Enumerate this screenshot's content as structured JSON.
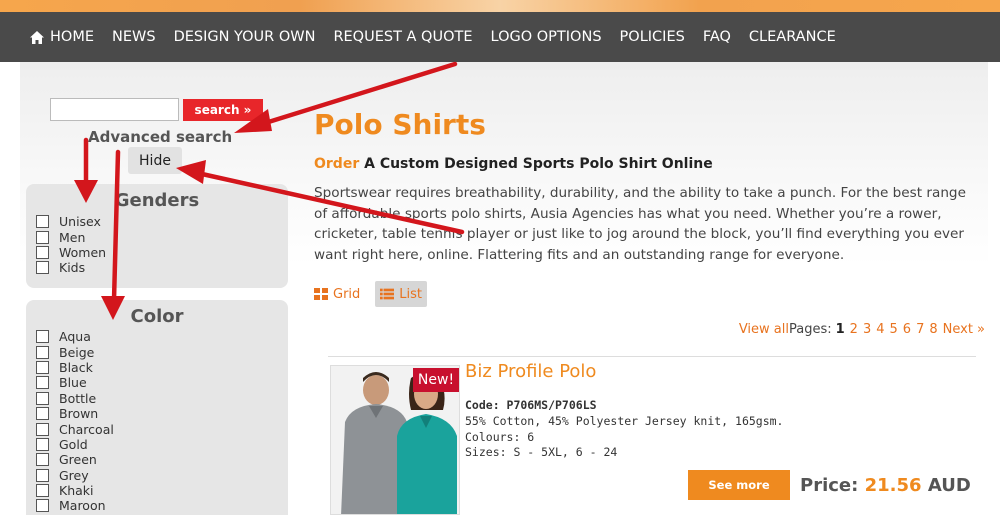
{
  "nav": {
    "items": [
      {
        "label": "HOME",
        "icon": "home-icon"
      },
      {
        "label": "NEWS"
      },
      {
        "label": "DESIGN YOUR OWN"
      },
      {
        "label": "REQUEST A QUOTE"
      },
      {
        "label": "LOGO OPTIONS"
      },
      {
        "label": "POLICIES"
      },
      {
        "label": "FAQ"
      },
      {
        "label": "CLEARANCE"
      }
    ]
  },
  "sidebar": {
    "search_value": "",
    "search_button": "search »",
    "advanced_search": "Advanced search",
    "hide_button": "Hide",
    "genders": {
      "title": "Genders",
      "options": [
        "Unisex",
        "Men",
        "Women",
        "Kids"
      ]
    },
    "color": {
      "title": "Color",
      "options": [
        "Aqua",
        "Beige",
        "Black",
        "Blue",
        "Bottle",
        "Brown",
        "Charcoal",
        "Gold",
        "Green",
        "Grey",
        "Khaki",
        "Maroon"
      ]
    }
  },
  "main": {
    "title": "Polo Shirts",
    "subtitle_accent": "Order",
    "subtitle_rest": "A Custom Designed Sports Polo Shirt Online",
    "description": "Sportswear requires breathability, durability, and the ability to take a punch. For the best range of affordable sports polo shirts, Ausia Agencies has what you need. Whether you’re a rower, cricketer, table tennis player or just like to jog around the block, you’ll find everything you ever want right here, online. Flattering fits and an outstanding range for everyone.",
    "view_grid": "Grid",
    "view_list": "List",
    "selected_view": "List",
    "pagination": {
      "view_all": "View all",
      "pages_label": "Pages:",
      "current": "1",
      "pages": [
        "2",
        "3",
        "4",
        "5",
        "6",
        "7",
        "8"
      ],
      "next": "Next »"
    },
    "product": {
      "badge": "New!",
      "name": "Biz Profile Polo",
      "code": "Code: P706MS/P706LS",
      "material": "55% Cotton, 45% Polyester Jersey knit, 165gsm.",
      "colours": "Colours: 6",
      "sizes": "Sizes: S - 5XL, 6 - 24",
      "see_more": "See more",
      "price_label": "Price:",
      "price_value": "21.56",
      "currency": "AUD"
    }
  },
  "colors": {
    "accent_orange": "#ef8a1f",
    "nav_bg": "#4a4a4a",
    "search_red": "#e8262a",
    "badge_red": "#c8102e",
    "annotation_arrow": "#d3161c"
  }
}
